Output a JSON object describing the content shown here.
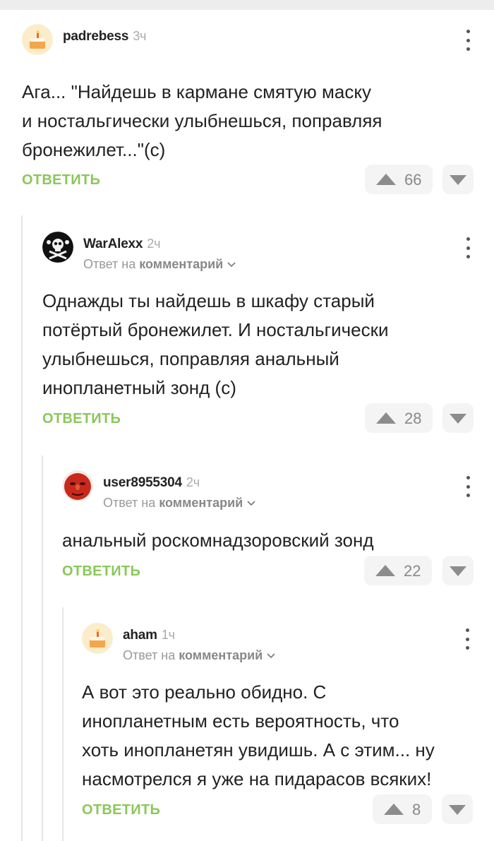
{
  "comments": [
    {
      "username": "padrebess",
      "time": "3ч",
      "avatar": "cake-avatar-icon",
      "reply_prefix": "",
      "reply_target": "",
      "lines": [
        "Ага... \"Найдешь в кармане смятую маску",
        "и ностальгически улыбнешься, поправляя",
        "бронежилет...\"(с)"
      ],
      "reply_label": "ОТВЕТИТЬ",
      "rating": "66"
    },
    {
      "username": "WarAlexx",
      "time": "2ч",
      "avatar": "jolly-roger-avatar-icon",
      "reply_prefix": "Ответ на",
      "reply_target": "комментарий",
      "lines": [
        "Однажды ты найдешь в шкафу старый",
        "потёртый бронежилет. И ностальгически",
        "улыбнешься, поправляя анальный",
        "инопланетный зонд (с)"
      ],
      "reply_label": "ОТВЕТИТЬ",
      "rating": "28"
    },
    {
      "username": "user8955304",
      "time": "2ч",
      "avatar": "red-face-avatar-icon",
      "reply_prefix": "Ответ на",
      "reply_target": "комментарий",
      "lines": [
        "анальный роскомнадзоровский зонд"
      ],
      "reply_label": "ОТВЕТИТЬ",
      "rating": "22"
    },
    {
      "username": "aham",
      "time": "1ч",
      "avatar": "cake-avatar-icon",
      "reply_prefix": "Ответ на",
      "reply_target": "комментарий",
      "lines": [
        "А вот это реально обидно. С",
        "инопланетным есть вероятность, что",
        "хоть инопланетян увидишь. А с этим... ну",
        "насмотрелся я уже на пидарасов всяких!"
      ],
      "reply_label": "ОТВЕТИТЬ",
      "rating": "8"
    }
  ],
  "colors": {
    "accent_green": "#8ac858",
    "vote_bg": "#f4f4f4",
    "thread_line": "#e6e6e6"
  }
}
